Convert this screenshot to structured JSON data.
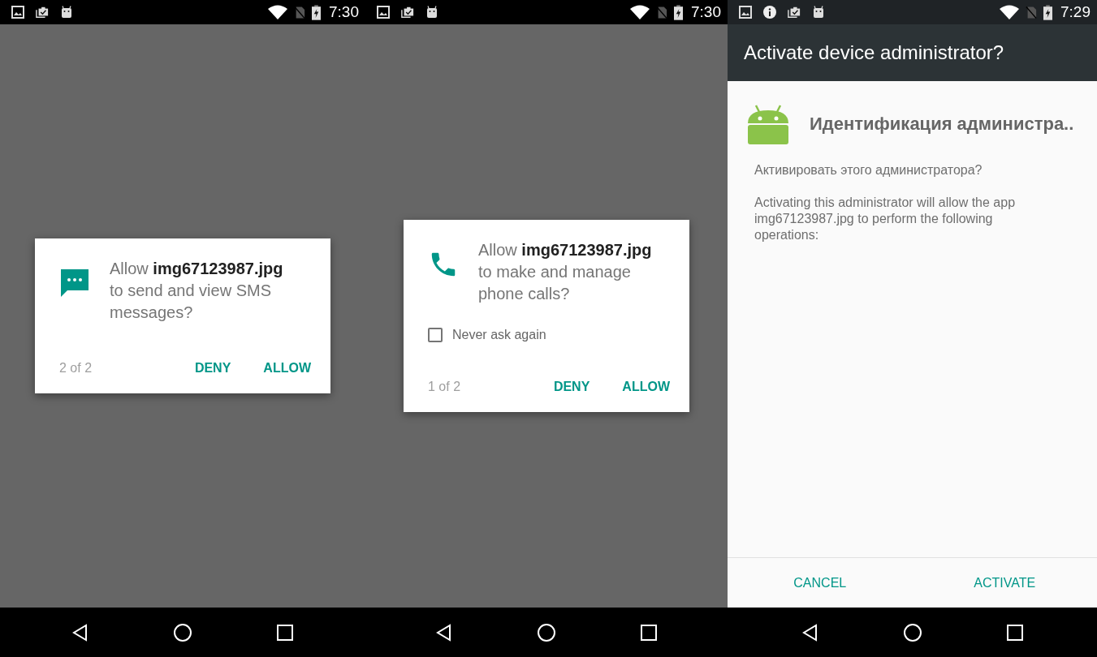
{
  "screens": [
    {
      "kind": "permission",
      "status_bar": {
        "time": "7:30",
        "notifications": [
          {
            "kind": "image"
          },
          {
            "kind": "clipboard"
          },
          {
            "kind": "android"
          }
        ]
      },
      "dialog": {
        "kind": "sms",
        "message": "Allow **img67123987.jpg** to send and view SMS messages?",
        "counter": "2 of 2",
        "buttons": [
          "DENY",
          "ALLOW"
        ]
      }
    },
    {
      "kind": "permission",
      "status_bar": {
        "time": "7:30",
        "notifications": [
          {
            "kind": "image"
          },
          {
            "kind": "clipboard"
          },
          {
            "kind": "android"
          }
        ]
      },
      "dialog": {
        "kind": "phone",
        "message": "Allow **img67123987.jpg** to make and manage phone calls?",
        "checkbox": {
          "label": "Never ask again",
          "checked": false
        },
        "counter": "1 of 2",
        "buttons": [
          "DENY",
          "ALLOW"
        ]
      }
    },
    {
      "kind": "admin",
      "status_bar": {
        "time": "7:29",
        "notifications": [
          {
            "kind": "image"
          },
          {
            "kind": "info"
          },
          {
            "kind": "clipboard"
          },
          {
            "kind": "android"
          }
        ]
      },
      "title": "Activate device administrator?",
      "app_name": "Идентификация администра..",
      "question": "Активировать этого администратора?",
      "description": "Activating this administrator will allow the app img67123987.jpg to perform the following operations:",
      "buttons": [
        "CANCEL",
        "ACTIVATE"
      ]
    }
  ]
}
